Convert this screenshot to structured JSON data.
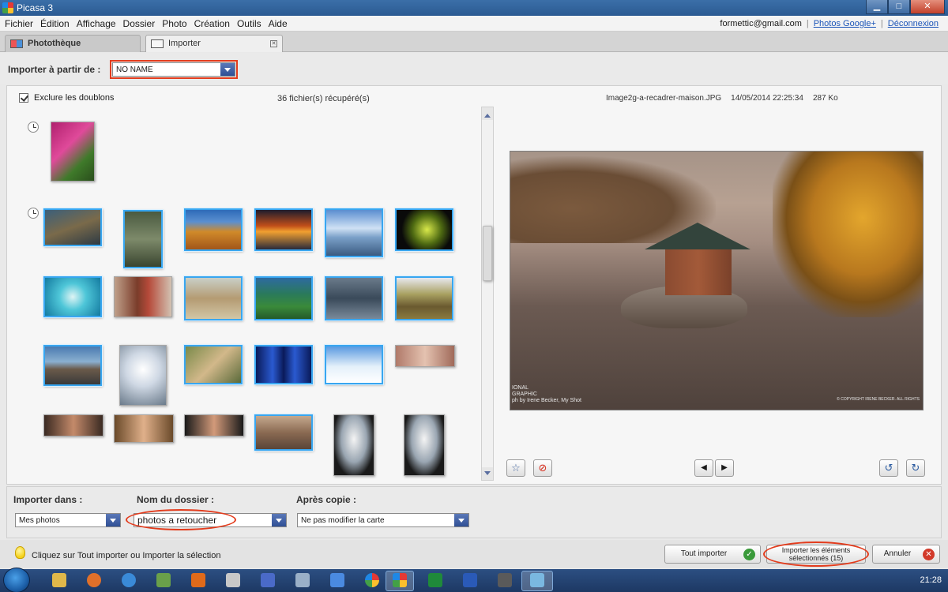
{
  "window": {
    "title": "Picasa 3",
    "buttons": {
      "minimize": "▁",
      "maximize": "□",
      "close": "✕"
    }
  },
  "menu": {
    "items": [
      "Fichier",
      "Édition",
      "Affichage",
      "Dossier",
      "Photo",
      "Création",
      "Outils",
      "Aide"
    ]
  },
  "account": {
    "email": "formettic@gmail.com",
    "sep": "|",
    "photos_link": "Photos Google+",
    "logout": "Déconnexion"
  },
  "tabs": [
    {
      "label": "Photothèque"
    },
    {
      "label": "Importer"
    }
  ],
  "import_source": {
    "label": "Importer à partir de :",
    "value": "NO NAME"
  },
  "browser": {
    "exclude_dupes": "Exclure les doublons",
    "exclude_dupes_checked": true,
    "count": "36 fichier(s) récupéré(s)",
    "file_name": "Image2g-a-recadrer-maison.JPG",
    "file_date": "14/05/2014 22:25:34",
    "file_size": "287 Ko"
  },
  "preview": {
    "credit_line1": "IONAL",
    "credit_line2": "GRAPHIC",
    "credit_line3": "ph by Irene Becker, My Shot",
    "copyright": "© COPYRIGHT IRENE BECKER. ALL RIGHTS"
  },
  "tools": {
    "star": "☆",
    "reject": "⊘",
    "prev": "◀",
    "next": "▶",
    "rotate_left": "↺",
    "rotate_right": "↻"
  },
  "options": {
    "dest_label": "Importer dans :",
    "dest_value": "Mes photos",
    "folder_label": "Nom du dossier :",
    "folder_value": "photos a retoucher",
    "after_label": "Après copie :",
    "after_value": "Ne pas modifier la carte"
  },
  "status": {
    "hint": "Cliquez sur Tout importer ou Importer la sélection",
    "import_all": "Tout importer",
    "import_selected_line1": "Importer les éléments",
    "import_selected_line2": "sélectionnés (15)",
    "cancel": "Annuler"
  },
  "taskbar": {
    "clock": "21:28"
  },
  "colors": {
    "selection": "#38a6f0",
    "highlight": "#e33c1d",
    "accent_dropdown": "#2f4f95"
  }
}
